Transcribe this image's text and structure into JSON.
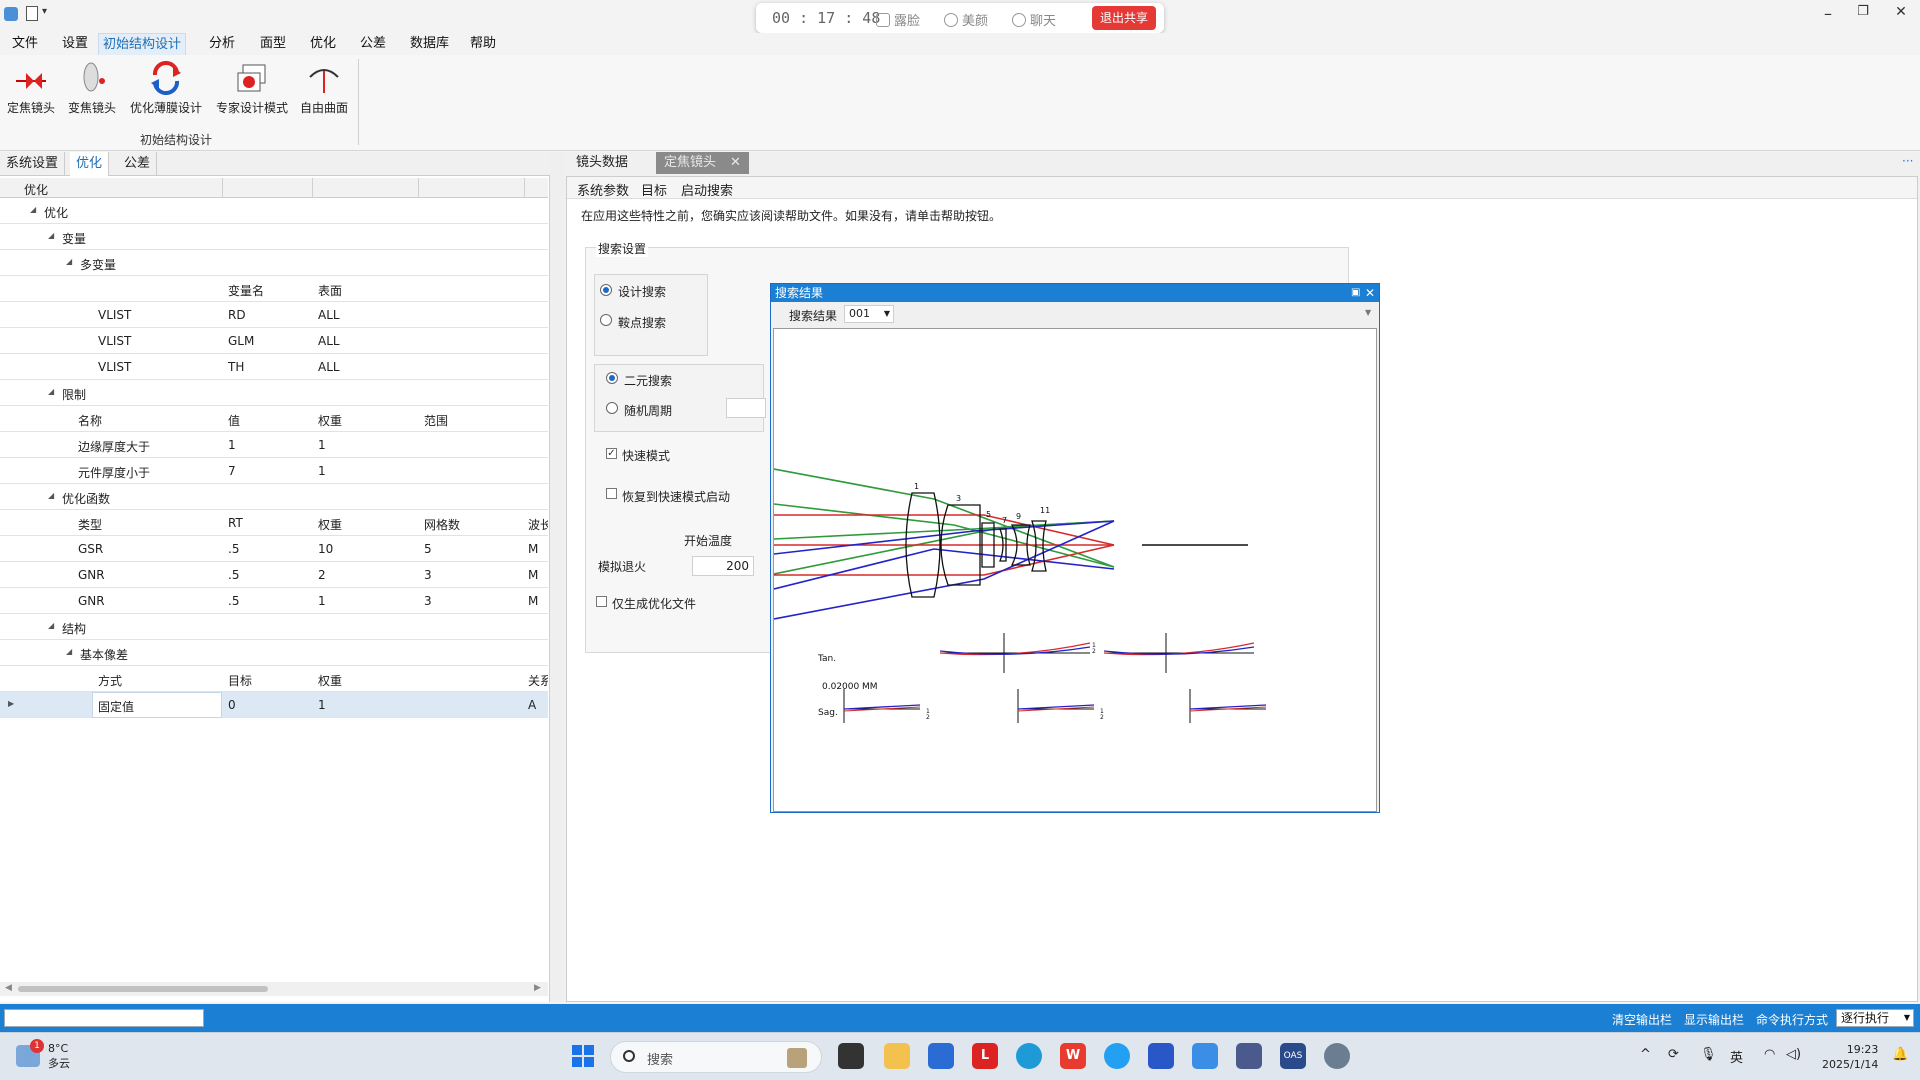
{
  "titlebar": {
    "timer": "00 : 17 : 48",
    "share_items": [
      "露脸",
      "美颜",
      "聊天"
    ],
    "exit_share": "退出共享",
    "minimize": "–",
    "restore": "❐",
    "close": "✕"
  },
  "menu": [
    "文件",
    "设置",
    "初始结构设计",
    "分析",
    "面型",
    "优化",
    "公差",
    "数据库",
    "帮助"
  ],
  "ribbon": {
    "buttons": [
      "定焦镜头",
      "变焦镜头",
      "优化薄膜设计",
      "专家设计模式",
      "自由曲面"
    ],
    "group_label": "初始结构设计"
  },
  "left_tabs": [
    "系统设置",
    "优化",
    "公差"
  ],
  "grid": {
    "header": "优化",
    "rows": [
      {
        "indent": 1,
        "tri": "◢",
        "cells": [
          "优化"
        ]
      },
      {
        "indent": 2,
        "tri": "◢",
        "cells": [
          "变量"
        ]
      },
      {
        "indent": 3,
        "tri": "◢",
        "cells": [
          "多变量"
        ]
      },
      {
        "cols": [
          "",
          "变量名",
          "表面",
          "",
          ""
        ]
      },
      {
        "cols": [
          "VLIST",
          "RD",
          "ALL",
          "",
          ""
        ]
      },
      {
        "cols": [
          "VLIST",
          "GLM",
          "ALL",
          "",
          ""
        ]
      },
      {
        "cols": [
          "VLIST",
          "TH",
          "ALL",
          "",
          ""
        ]
      },
      {
        "indent": 2,
        "tri": "◢",
        "cells": [
          "限制"
        ]
      },
      {
        "cols2": [
          "名称",
          "值",
          "权重",
          "范围",
          ""
        ]
      },
      {
        "cols2": [
          "边缘厚度大于",
          "1",
          "1",
          "",
          ""
        ]
      },
      {
        "cols2": [
          "元件厚度小于",
          "7",
          "1",
          "",
          ""
        ]
      },
      {
        "indent": 2,
        "tri": "◢",
        "cells": [
          "优化函数"
        ]
      },
      {
        "cols2": [
          "类型",
          "RT",
          "权重",
          "网格数",
          "波长"
        ]
      },
      {
        "cols2": [
          "GSR",
          ".5",
          "10",
          "5",
          "M"
        ]
      },
      {
        "cols2": [
          "GNR",
          ".5",
          "2",
          "3",
          "M"
        ]
      },
      {
        "cols2": [
          "GNR",
          ".5",
          "1",
          "3",
          "M"
        ]
      },
      {
        "indent": 2,
        "tri": "◢",
        "cells": [
          "结构"
        ]
      },
      {
        "indent": 3,
        "tri": "◢",
        "cells": [
          "基本像差"
        ]
      },
      {
        "cols": [
          "方式",
          "目标",
          "权重",
          "",
          "关系"
        ]
      },
      {
        "cols": [
          "固定值",
          "0",
          "1",
          "",
          "A"
        ],
        "selected": true
      }
    ]
  },
  "doc_tabs": [
    "镜头数据",
    "定焦镜头"
  ],
  "doc_toolbar": [
    "系统参数",
    "目标",
    "启动搜索"
  ],
  "info_line": "在应用这些特性之前，您确实应该阅读帮助文件。如果没有，请单击帮助按钮。",
  "search": {
    "group_title": "搜索设置",
    "radio_design": "设计搜索",
    "radio_saddle": "鞍点搜索",
    "radio_binary": "二元搜索",
    "radio_random": "随机周期",
    "fast_mode": "快速模式",
    "restore_fast": "恢复到快速模式启动",
    "start_temp": "开始温度",
    "annealing": "模拟退火",
    "annealing_value": "200",
    "only_gen": "仅生成优化文件"
  },
  "result_window": {
    "title": "搜索结果",
    "label": "搜索结果",
    "selected": "001",
    "surface_labels": [
      "1",
      "3",
      "5",
      "7",
      "9",
      "11"
    ],
    "tan_label": "Tan.",
    "sag_label": "Sag.",
    "scale_value": "0.02000",
    "scale_unit": "MM",
    "curve_tags": [
      "1",
      "2",
      "3"
    ]
  },
  "statusbar": [
    "清空输出栏",
    "显示输出栏",
    "命令执行方式"
  ],
  "run_mode": "逐行执行",
  "taskbar": {
    "search_placeholder": "搜索",
    "weather_temp": "8°C",
    "weather_desc": "多云",
    "weather_badge": "1",
    "ime": "英",
    "time": "19:23",
    "date": "2025/1/14"
  },
  "colors": {
    "accent": "#1b7fd3",
    "ray_green": "#2e9a3a",
    "ray_red": "#d62b2b",
    "ray_blue": "#2323c8"
  }
}
